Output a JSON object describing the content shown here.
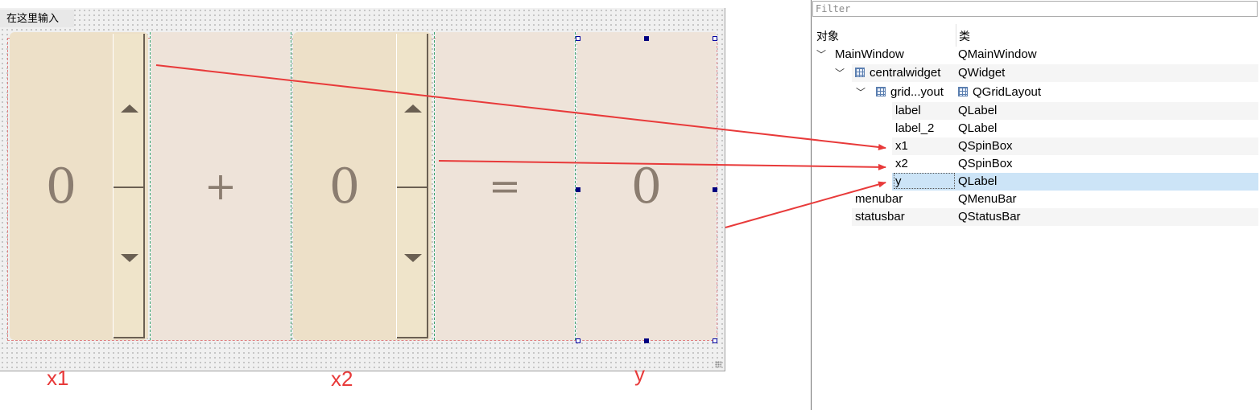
{
  "form": {
    "menu_hint": "在这里输入",
    "x1_value": "0",
    "plus_label": "+",
    "x2_value": "0",
    "equals_label": "=",
    "y_value": "0"
  },
  "annotations": [
    "x1",
    "x2",
    "y"
  ],
  "annotation_color": "#e83a3a",
  "inspector": {
    "filter_placeholder": "Filter",
    "col_object": "对象",
    "col_class": "类",
    "rows": [
      {
        "object": "MainWindow",
        "class": "QMainWindow"
      },
      {
        "object": "centralwidget",
        "class": "QWidget"
      },
      {
        "object": "grid...yout",
        "class": "QGridLayout"
      },
      {
        "object": "label",
        "class": "QLabel"
      },
      {
        "object": "label_2",
        "class": "QLabel"
      },
      {
        "object": "x1",
        "class": "QSpinBox"
      },
      {
        "object": "x2",
        "class": "QSpinBox"
      },
      {
        "object": "y",
        "class": "QLabel",
        "selected": true
      },
      {
        "object": "menubar",
        "class": "QMenuBar"
      },
      {
        "object": "statusbar",
        "class": "QStatusBar"
      }
    ],
    "selection_color": "#cce4f7"
  }
}
